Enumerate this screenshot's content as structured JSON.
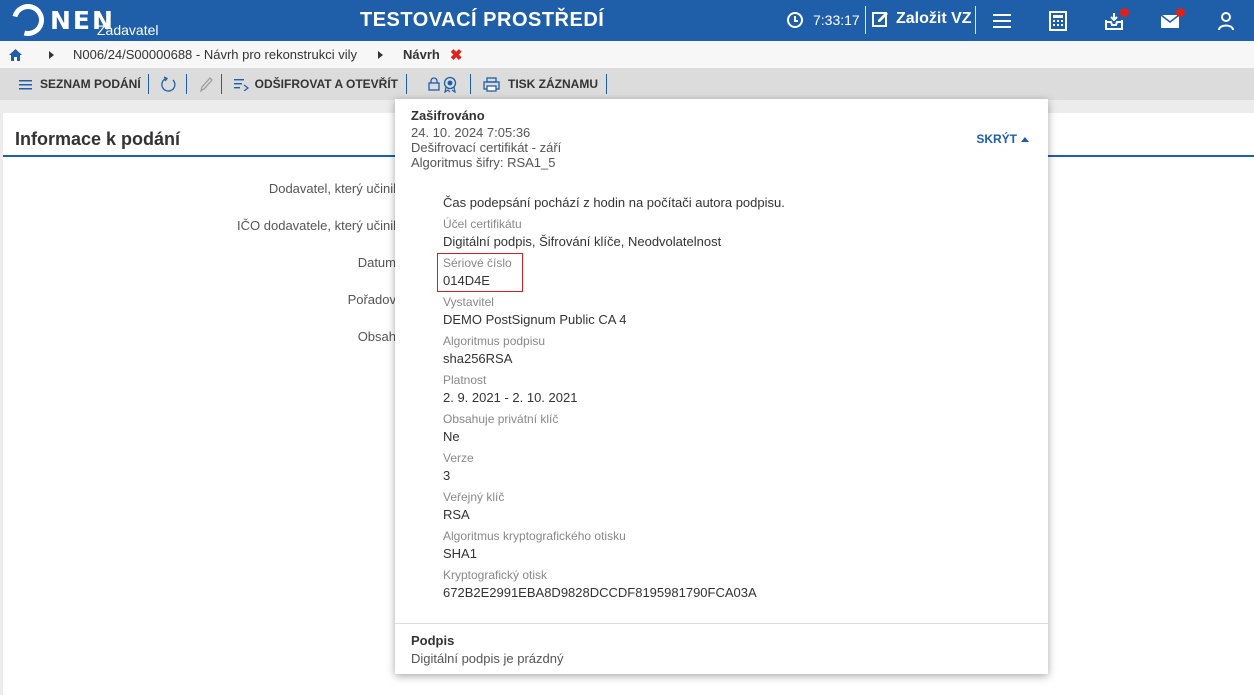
{
  "app": {
    "logo_text": "NEN",
    "logo_sub": "Zadavatel",
    "env_title": "TESTOVACÍ PROSTŘEDÍ"
  },
  "header": {
    "time": "7:33:17",
    "create_label": "Založit VZ",
    "icons": [
      "menu-icon",
      "calculator-icon",
      "inbox-icon",
      "mail-icon",
      "user-icon"
    ],
    "notification_color": "#e0201b",
    "brand_color": "#1f5ea8"
  },
  "breadcrumb": {
    "path": "N006/24/S00000688 - Návrh pro rekonstrukci vily",
    "current": "Návrh",
    "close": "✖"
  },
  "toolbar": {
    "list_label": "SEZNAM PODÁNÍ",
    "decrypt_label": "ODŠIFROVAT A OTEVŘÍT",
    "print_label": "TISK ZÁZNAMU"
  },
  "main": {
    "title": "Informace k podání",
    "labels": [
      "Dodavatel, který učinil",
      "IČO dodavatele, který učinil",
      "Datum",
      "Pořadov",
      "Obsah"
    ]
  },
  "popup": {
    "title": "Zašifrováno",
    "date": "24. 10. 2024 7:05:36",
    "cert": "Dešifrovací certifikát - září",
    "algo": "Algoritmus šifry: RSA1_5",
    "hide_label": "SKRÝT",
    "note": "Čas podepsání pochází z hodin na počítači autora podpisu.",
    "fields": [
      {
        "label": "Účel certifikátu",
        "value": "Digitální podpis, Šifrování klíče, Neodvolatelnost"
      },
      {
        "label": "Sériové číslo",
        "value": "014D4E"
      },
      {
        "label": "Vystavitel",
        "value": "DEMO PostSignum Public CA 4"
      },
      {
        "label": "Algoritmus podpisu",
        "value": "sha256RSA"
      },
      {
        "label": "Platnost",
        "value": "2. 9. 2021 - 2. 10. 2021"
      },
      {
        "label": "Obsahuje privátní klíč",
        "value": "Ne"
      },
      {
        "label": "Verze",
        "value": "3"
      },
      {
        "label": "Veřejný klíč",
        "value": "RSA"
      },
      {
        "label": "Algoritmus kryptografického otisku",
        "value": "SHA1"
      },
      {
        "label": "Kryptografický otisk",
        "value": "672B2E2991EBA8D9828DCCDF8195981790FCA03A"
      }
    ],
    "signature_title": "Podpis",
    "signature_value": "Digitální podpis je prázdný"
  }
}
